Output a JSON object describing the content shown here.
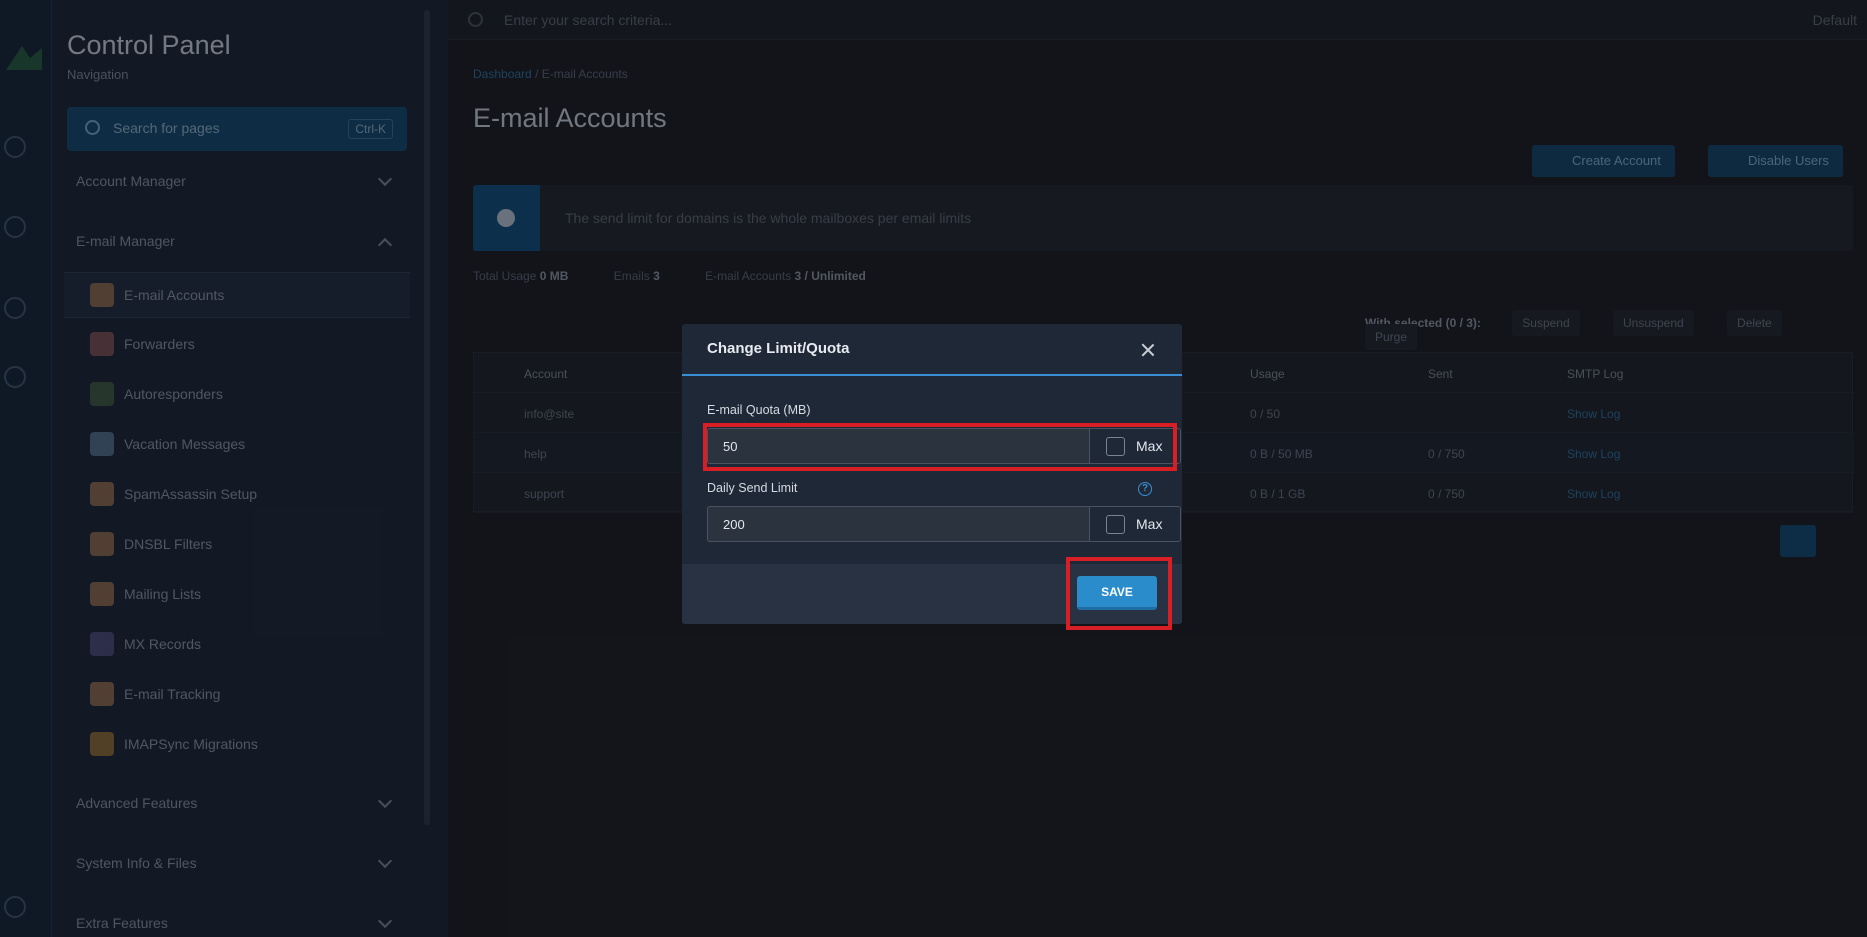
{
  "background": {
    "sidebar": {
      "title": "Control Panel",
      "subtitle": "Navigation",
      "search_placeholder": "Search for pages",
      "search_shortcut": "Ctrl-K",
      "sections": [
        "Account Manager",
        "E-mail Manager",
        "Advanced Features",
        "System Info & Files",
        "Extra Features"
      ],
      "items": [
        "E-mail Accounts",
        "Forwarders",
        "Autoresponders",
        "Vacation Messages",
        "SpamAssassin Setup",
        "DNSBL Filters",
        "Mailing Lists",
        "MX Records",
        "E-mail Tracking",
        "IMAPSync Migrations"
      ]
    },
    "topbar": {
      "search_placeholder": "Enter your search criteria...",
      "right": "Default"
    },
    "breadcrumb": {
      "home": "Dashboard",
      "current": "E-mail Accounts"
    },
    "page_title": "E-mail Accounts",
    "buttons": {
      "create": "Create Account",
      "domain": "Disable Users"
    },
    "info_text": "The send limit for domains is the whole mailboxes per email limits",
    "stats": {
      "usage_label": "Total Usage",
      "usage": "0 MB",
      "emails_label": "Emails",
      "emails": "3",
      "accounts_label": "E-mail Accounts",
      "accounts": "3 / Unlimited"
    },
    "bulk": {
      "label": "With selected (0 / 3):",
      "actions": [
        "Suspend",
        "Unsuspend",
        "Delete",
        "Purge"
      ]
    },
    "table": {
      "headers": [
        "Account",
        "Usage",
        "Sent",
        "SMTP Log"
      ],
      "rows": [
        [
          "info@site",
          "0 / 50",
          "",
          "Show Log"
        ],
        [
          "help",
          "0 B / 50 MB",
          "0 / 750",
          "Show Log"
        ],
        [
          "support",
          "0 B / 1 GB",
          "0 / 750",
          "Show Log"
        ]
      ]
    }
  },
  "modal": {
    "title": "Change Limit/Quota",
    "quota_label": "E-mail Quota (MB)",
    "quota_value": "50",
    "send_label": "Daily Send Limit",
    "send_value": "200",
    "max_label": "Max",
    "help_glyph": "?",
    "save_label": "SAVE"
  },
  "colors": {
    "accent": "#2b8ccc",
    "highlight": "#d81f26",
    "modal_bg": "#1f2836"
  }
}
